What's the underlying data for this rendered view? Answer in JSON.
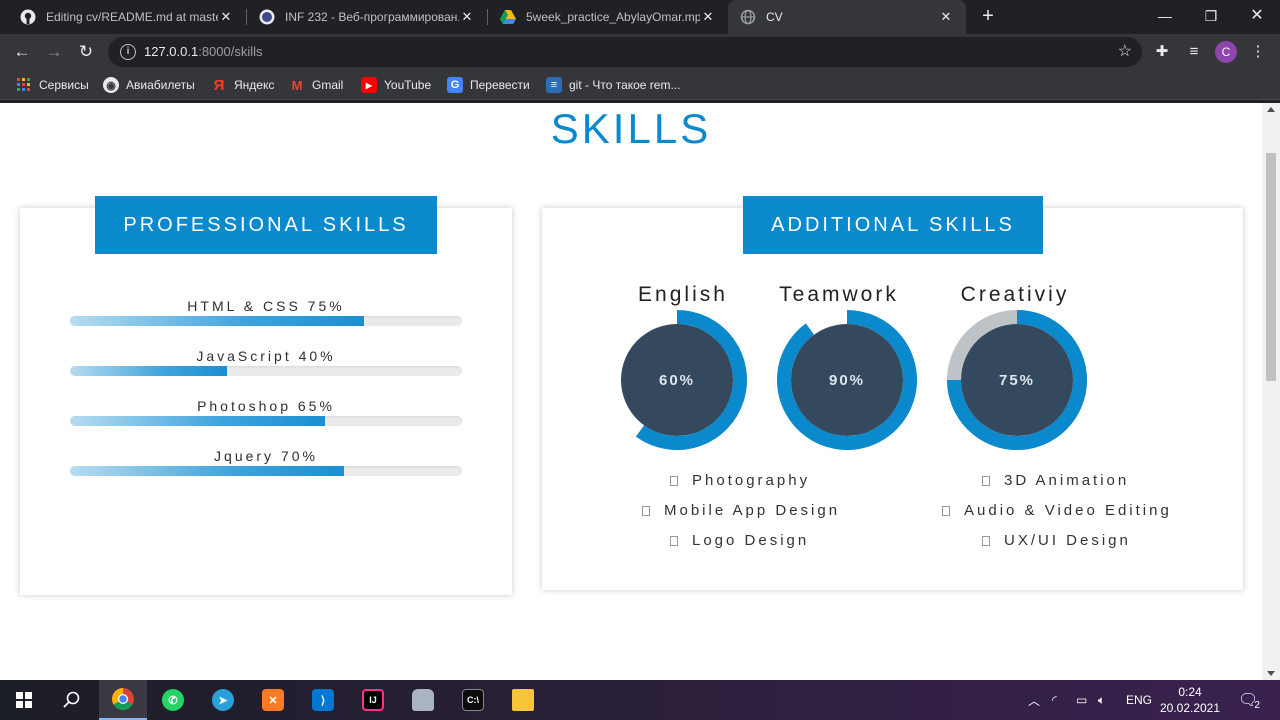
{
  "browser": {
    "tabs": [
      {
        "title": "Editing cv/README.md at master",
        "active": false
      },
      {
        "title": "INF 232 - Веб-программирован...",
        "active": false
      },
      {
        "title": "5week_practice_AbylayOmar.mp4",
        "active": false
      },
      {
        "title": "CV",
        "active": true
      }
    ],
    "url_host": "127.0.0.1",
    "url_path": ":8000/skills",
    "profile_initial": "C",
    "bookmarks": [
      "Сервисы",
      "Авиабилеты",
      "Яндекс",
      "Gmail",
      "YouTube",
      "Перевести",
      "git - Что такое rem..."
    ]
  },
  "page": {
    "title": "SKILLS",
    "professional": {
      "heading": "PROFESSIONAL SKILLS",
      "skills": [
        {
          "label": "HTML & CSS 75%",
          "value": 75
        },
        {
          "label": "JavaScript 40%",
          "value": 40
        },
        {
          "label": "Photoshop 65%",
          "value": 65
        },
        {
          "label": "Jquery 70%",
          "value": 70
        }
      ]
    },
    "additional": {
      "heading": "ADDITIONAL SKILLS",
      "donuts": [
        {
          "label": "English",
          "text": "60%",
          "value": 60
        },
        {
          "label": "Teamwork",
          "text": "90%",
          "value": 90
        },
        {
          "label": "Creativiy",
          "text": "75%",
          "value": 75
        }
      ],
      "list_left": [
        "Photography",
        "Mobile App Design",
        "Logo Design"
      ],
      "list_right": [
        "3D Animation",
        "Audio & Video Editing",
        "UX/UI Design"
      ]
    }
  },
  "taskbar": {
    "language": "ENG",
    "time": "0:24",
    "date": "20.02.2021",
    "notifications": "2"
  },
  "colors": {
    "accent": "#0a89cc",
    "donut_center": "#34495e",
    "donut_track": "#bdc3c7"
  }
}
